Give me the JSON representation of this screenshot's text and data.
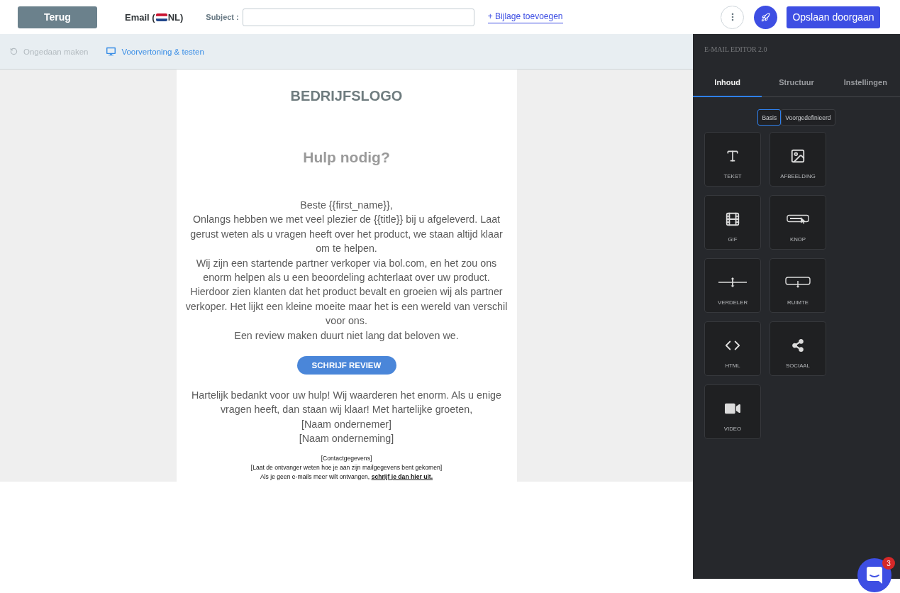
{
  "top_bar": {
    "back_button": "Terug",
    "channel_label": {
      "prefix": "Email (",
      "suffix": "NL)"
    },
    "subject": {
      "label": "Subject :"
    },
    "attachment_link": "+ Bijlage toevoegen",
    "save_button": "Opslaan doorgaan"
  },
  "toolbar": [
    {
      "label": "Ongedaan maken",
      "kind": "undo",
      "disabled": true
    },
    {
      "label": "Voorvertoning & testen",
      "kind": "preview",
      "disabled": false
    }
  ],
  "email": {
    "logo": "BEDRIJFSLOGO",
    "heading": "Hulp nodig?",
    "body": [
      "Beste {{first_name}},",
      "Onlangs hebben we met veel plezier de {{title}} bij u afgeleverd. Laat gerust weten als u vragen heeft over het product, we staan altijd klaar om te helpen.",
      "Wij zijn een startende partner verkoper via bol.com, en het zou ons enorm helpen als u een beoordeling achterlaat over uw product. Hierdoor zien klanten dat het product bevalt en groeien wij als partner verkoper. Het lijkt een kleine moeite maar het is een wereld van verschil voor ons.",
      "Een review maken duurt niet lang dat beloven we."
    ],
    "cta_button": "SCHRIJF REVIEW",
    "closing": [
      "Hartelijk bedankt voor uw hulp! Wij waarderen het enorm. Als u enige vragen heeft, dan staan wij klaar! Met hartelijke groeten,",
      "[Naam ondernemer]",
      "[Naam onderneming]"
    ],
    "footer": {
      "lines": [
        "[Contactgegevens]",
        "[Laat de ontvanger weten hoe je aan zijn mailgegevens bent gekomen]"
      ],
      "unsubscribe": {
        "text": "Als je geen e-mails meer wilt ontvangen,",
        "link": "schrijf je dan hier uit."
      }
    }
  },
  "editor_panel": {
    "title": "E-MAIL EDITOR 2.0",
    "tabs": [
      {
        "label": "Inhoud",
        "selected": true
      },
      {
        "label": "Structuur",
        "selected": false
      },
      {
        "label": "Instellingen",
        "selected": false
      }
    ],
    "block_sets": [
      {
        "label": "Basis",
        "selected": true
      },
      {
        "label": "Voorgedefinieerd",
        "selected": false
      }
    ],
    "blocks": [
      {
        "label": "TEKST",
        "kind": "text"
      },
      {
        "label": "AFBEELDING",
        "kind": "image"
      },
      {
        "label": "GIF",
        "kind": "gif"
      },
      {
        "label": "KNOP",
        "kind": "button"
      },
      {
        "label": "VERDELER",
        "kind": "divider"
      },
      {
        "label": "RUIMTE",
        "kind": "spacer"
      },
      {
        "label": "HTML",
        "kind": "html"
      },
      {
        "label": "SOCIAAL",
        "kind": "social"
      },
      {
        "label": "VIDEO",
        "kind": "video"
      }
    ]
  },
  "chat": {
    "badge": "3"
  }
}
